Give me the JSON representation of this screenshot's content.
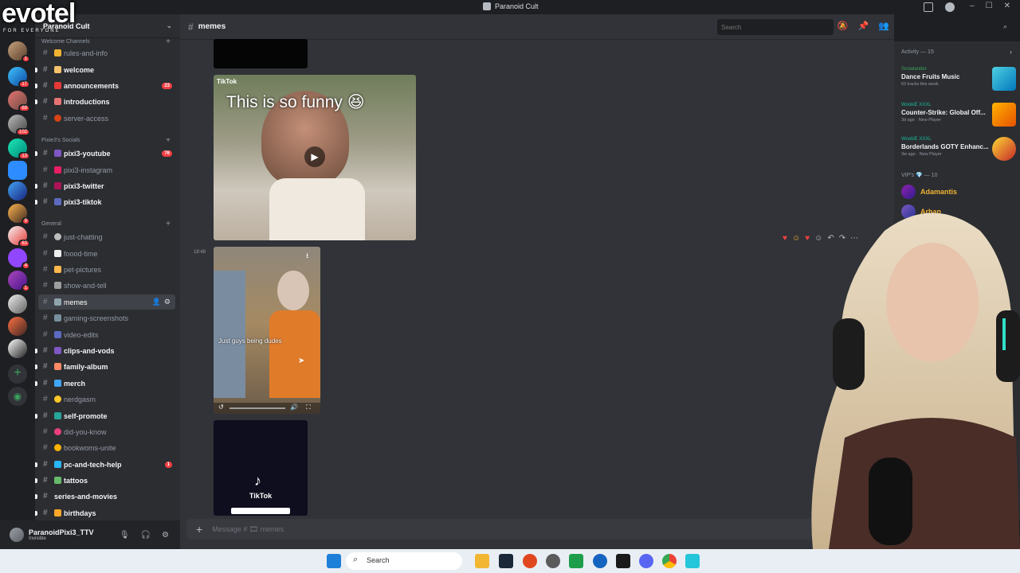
{
  "brand": {
    "name": "evotel",
    "tagline": "FOR EVERYONE"
  },
  "window": {
    "title": "Paranoid Cult"
  },
  "server": {
    "name": "Paranoid Cult"
  },
  "rail": {
    "badges": [
      "58",
      "1",
      "17",
      "69",
      "102",
      "13",
      "9",
      "63",
      "4",
      "1"
    ]
  },
  "categories": {
    "welcome": "Welcome Channels",
    "socials": "Pixie3's Socials",
    "general": "General"
  },
  "channels": [
    {
      "name": "rules-and-info"
    },
    {
      "name": "welcome"
    },
    {
      "name": "announcements",
      "badge": "23"
    },
    {
      "name": "introductions"
    },
    {
      "name": "server-access"
    },
    {
      "name": "pixi3-youtube",
      "badge": "76"
    },
    {
      "name": "pixi3-instagram"
    },
    {
      "name": "pixi3-twitter"
    },
    {
      "name": "pixi3-tiktok"
    },
    {
      "name": "just-chatting"
    },
    {
      "name": "foood-time"
    },
    {
      "name": "pet-pictures"
    },
    {
      "name": "show-and-tell"
    },
    {
      "name": "memes"
    },
    {
      "name": "gaming-screenshots"
    },
    {
      "name": "video-edits"
    },
    {
      "name": "clips-and-vods"
    },
    {
      "name": "family-album"
    },
    {
      "name": "merch"
    },
    {
      "name": "nerdgasm"
    },
    {
      "name": "self-promote"
    },
    {
      "name": "did-you-know"
    },
    {
      "name": "bookwoms-unite"
    },
    {
      "name": "pc-and-tech-help",
      "badge": "1"
    },
    {
      "name": "tattoos"
    },
    {
      "name": "series-and-movies"
    },
    {
      "name": "birthdays"
    }
  ],
  "user": {
    "name": "ParanoidPixi3_TTV",
    "status": "Invisible"
  },
  "chat": {
    "channel": "memes",
    "search_placeholder": "Search",
    "timestamp": "18:48",
    "video1_caption": "This is so funny 😆",
    "video1_label": "TikTok",
    "video2_caption": "Just guys being dudes",
    "video3_label": "TikTok",
    "composer_placeholder": "Message # 🎞 memes"
  },
  "activity": {
    "header": "Activity — 15",
    "items": [
      {
        "user": "Snowlander",
        "game": "Dance Fruits Music",
        "meta": "63 tracks this week"
      },
      {
        "user": "WookiE XXXL",
        "game": "Counter-Strike: Global Off...",
        "meta": "3d ago · New Player"
      },
      {
        "user": "WookiE XXXL",
        "game": "Borderlands GOTY Enhanc...",
        "meta": "3w ago · New Player"
      }
    ],
    "vip_header": "VIP's 💎 — 10",
    "vips": [
      {
        "name": "Adamantis"
      },
      {
        "name": "Arhan"
      }
    ]
  },
  "taskbar": {
    "search_label": "Search"
  },
  "colors": {
    "accent": "#5865f2",
    "mention": "#f23f43",
    "online": "#3ba55c",
    "vip_gold": "#f0b232"
  }
}
